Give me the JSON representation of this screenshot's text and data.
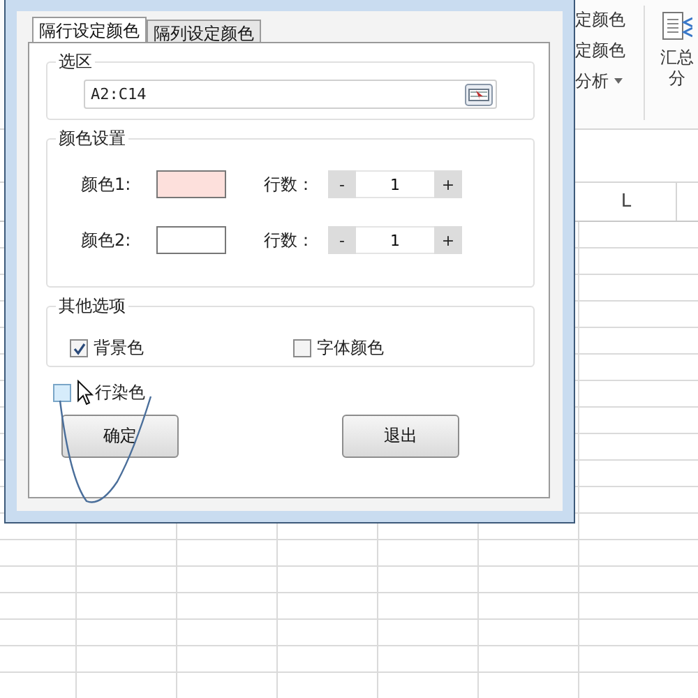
{
  "ribbon": {
    "items": [
      {
        "label": "定颜色",
        "dropdown": false
      },
      {
        "label": "定颜色",
        "dropdown": false
      },
      {
        "label": "分析",
        "dropdown": true
      }
    ],
    "summary_lines": [
      "汇总",
      "分"
    ]
  },
  "sheet": {
    "column_header": "L"
  },
  "dialog": {
    "tabs": [
      {
        "label": "隔行设定颜色",
        "selected": true
      },
      {
        "label": "隔列设定颜色",
        "selected": false
      }
    ],
    "selection_group": {
      "title": "选区",
      "range_value": "A2:C14"
    },
    "color_group": {
      "title": "颜色设置",
      "rows": [
        {
          "label": "颜色1:",
          "color": "#fde0dc",
          "count_label": "行数：",
          "minus": "-",
          "value": "1",
          "plus": "+"
        },
        {
          "label": "颜色2:",
          "color": "#ffffff",
          "count_label": "行数：",
          "minus": "-",
          "value": "1",
          "plus": "+"
        }
      ]
    },
    "options_group": {
      "title": "其他选项",
      "options": [
        {
          "label": "背景色",
          "checked": true
        },
        {
          "label": "字体颜色",
          "checked": false
        }
      ]
    },
    "alternate_option": {
      "label": "行染色",
      "checked": false
    },
    "buttons": [
      {
        "label": "确定"
      },
      {
        "label": "退出"
      }
    ]
  }
}
